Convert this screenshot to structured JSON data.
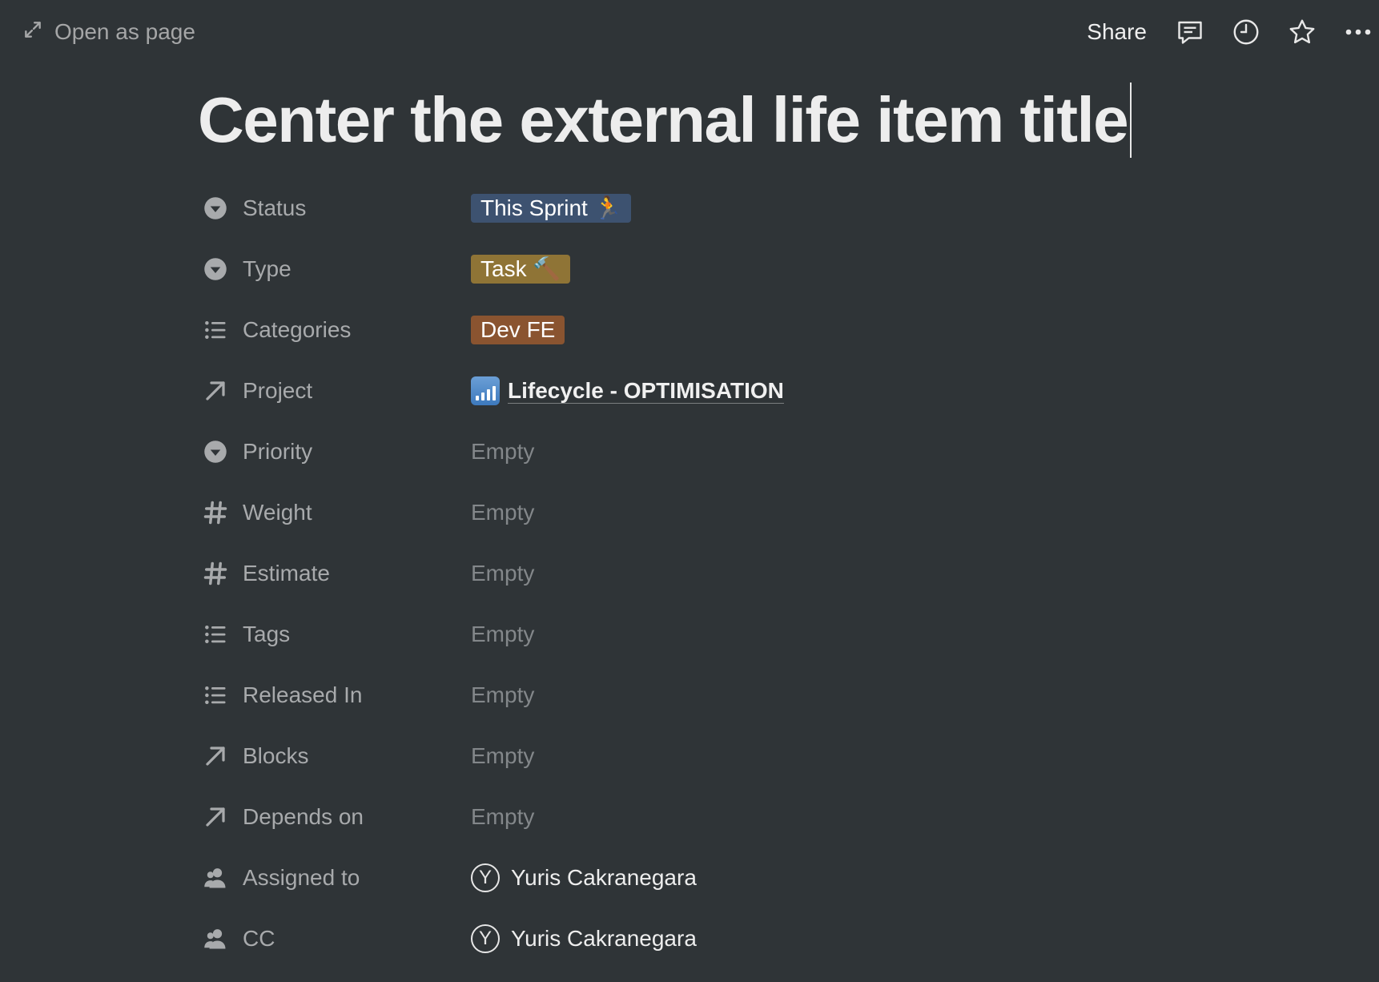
{
  "topbar": {
    "open_as_page": "Open as page",
    "share_label": "Share",
    "icons": [
      "expand-icon",
      "comment-icon",
      "history-clock-icon",
      "star-icon",
      "more-icon"
    ]
  },
  "page": {
    "title": "Center the external life item title"
  },
  "properties": {
    "status": {
      "label": "Status",
      "icon": "select-icon",
      "value": "This Sprint 🏃",
      "color": "#3d5270"
    },
    "type": {
      "label": "Type",
      "icon": "select-icon",
      "value": "Task 🔨",
      "color": "#8f7436"
    },
    "categories": {
      "label": "Categories",
      "icon": "list-icon",
      "value": "Dev FE",
      "color": "#8a5430"
    },
    "project": {
      "label": "Project",
      "icon": "relation-arrow-icon",
      "value": "Lifecycle - OPTIMISATION",
      "value_icon": "signal-bars-icon"
    },
    "priority": {
      "label": "Priority",
      "icon": "select-icon",
      "value": "Empty"
    },
    "weight": {
      "label": "Weight",
      "icon": "number-icon",
      "value": "Empty"
    },
    "estimate": {
      "label": "Estimate",
      "icon": "number-icon",
      "value": "Empty"
    },
    "tags": {
      "label": "Tags",
      "icon": "list-icon",
      "value": "Empty"
    },
    "released_in": {
      "label": "Released In",
      "icon": "list-icon",
      "value": "Empty"
    },
    "blocks": {
      "label": "Blocks",
      "icon": "relation-arrow-icon",
      "value": "Empty"
    },
    "depends_on": {
      "label": "Depends on",
      "icon": "relation-arrow-icon",
      "value": "Empty"
    },
    "assigned_to": {
      "label": "Assigned to",
      "icon": "person-icon",
      "value": "Yuris Cakranegara",
      "avatar_initial": "Y"
    },
    "cc": {
      "label": "CC",
      "icon": "person-icon",
      "value": "Yuris Cakranegara",
      "avatar_initial": "Y"
    }
  }
}
